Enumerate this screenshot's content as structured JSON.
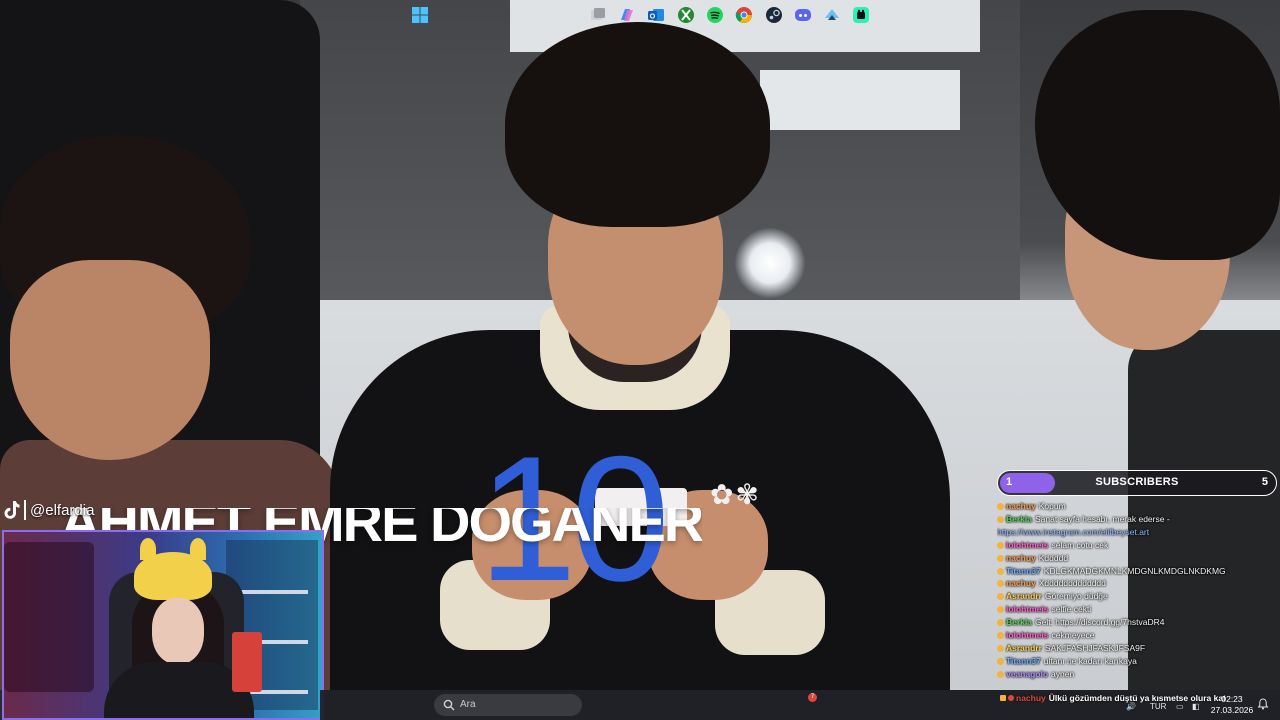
{
  "overlay": {
    "number": "10",
    "name_banner": "AHMET EMRE DOĞANER",
    "tiktok_handle": "@elfardia"
  },
  "subscribers": {
    "current": "1",
    "label": "SUBSCRIBERS",
    "goal": "5",
    "progress": 0.2,
    "color": "#8f62ea"
  },
  "chat": {
    "messages": [
      {
        "user": "nachuy",
        "text": "Kopum",
        "color": "#ff9d4d"
      },
      {
        "user": "Berkla",
        "text": "Sanat sayfa hesabı, merak ederse -",
        "color": "#5fd35f"
      },
      {
        "user": "",
        "text": "https://www.instagram.com/elifbeyset.art",
        "color": "#8fb6ff"
      },
      {
        "user": "lolohtmeis",
        "text": "selam cotu cek",
        "color": "#ff5ec7"
      },
      {
        "user": "nachuy",
        "text": "Kddddd",
        "color": "#ff9d4d"
      },
      {
        "user": "Titann37",
        "text": "KDLGKMADGKMNLKMDGNLKMDGLNKDKMG",
        "color": "#6fa8ff"
      },
      {
        "user": "nachuy",
        "text": "Xddddddddddddd",
        "color": "#ff9d4d"
      },
      {
        "user": "Asrandrr",
        "text": "Göremiyo düdğe",
        "color": "#ffd24d"
      },
      {
        "user": "lolohtmeis",
        "text": "selfie cekti",
        "color": "#ff5ec7"
      },
      {
        "user": "Berkla",
        "text": "Gelt: https://discord.gg/7hstvaDR4",
        "color": "#5fd35f"
      },
      {
        "user": "lolohtmeis",
        "text": "cekmeyece",
        "color": "#ff5ec7"
      },
      {
        "user": "Asrandrr",
        "text": "SAKJFASHJFASKJFSA9F",
        "color": "#ffd24d"
      },
      {
        "user": "Titann37",
        "text": "ultanı ne kadarı karıkaya",
        "color": "#6fa8ff"
      },
      {
        "user": "veanagolo",
        "text": "aynen",
        "color": "#b18cff"
      }
    ]
  },
  "ticker": {
    "user": "nachuy",
    "text": "Ülkü gözümden düştü ya kısmetse olura katılmış"
  },
  "taskbar": {
    "search_placeholder": "Ara",
    "discord_badge": "7",
    "apps": [
      "windows-start",
      "task-view",
      "copilot",
      "outlook",
      "xbox",
      "spotify",
      "chrome",
      "steam",
      "discord",
      "steam-2",
      "tiktok-live"
    ]
  },
  "tray": {
    "language": "TUR",
    "time": "02:23",
    "date": "27.03.2026"
  },
  "colors": {
    "accent_blue": "#2f5ed6",
    "purple": "#8b6df0"
  }
}
